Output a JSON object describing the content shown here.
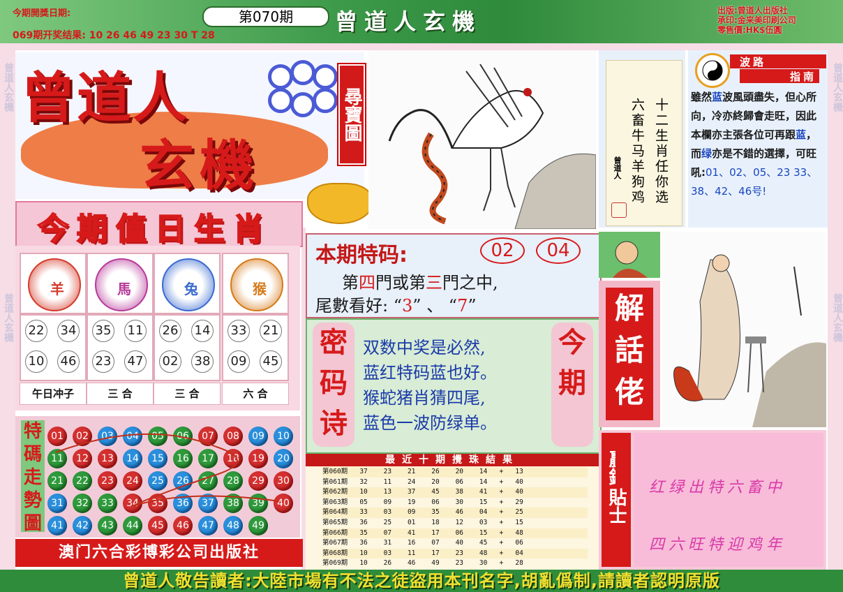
{
  "header": {
    "open_date_label": "今期開獎日期:",
    "last_result_label": "069期开奖结果:",
    "last_result_numbers": "10 26 46 49 23 30 T 28",
    "issue": "第070期",
    "title": "曾道人玄機",
    "publisher_line": "出版:曾道人出版社",
    "printer_line": "承印:金来美印刷公司",
    "price_line": "零售價:HK$伍圓"
  },
  "logo": {
    "line1": "曾道人",
    "line2": "玄機",
    "tag": "尋寶圖"
  },
  "border_text": "曾道人玄機",
  "zodiac_poem": {
    "col1": "十二生肖任你选",
    "col2": "六畜牛马羊狗鸡",
    "signature": "曾道人"
  },
  "wave_guide": {
    "title1": "波路",
    "title2": "指南",
    "text1": "雖然",
    "text_blue": "蓝",
    "text2": "波風頭盡失，但心所向，冷亦終歸會走旺，因此本欄亦主張各位可再跟",
    "text_blue2": "蓝",
    "text3": "，而",
    "text_green": "绿",
    "text4": "亦是不錯的選擇，可旺吼:",
    "numbers": "01、02、05、23 33、38、42、46号!"
  },
  "zodiac_of_day": {
    "title": "今期值日生肖",
    "animals": [
      {
        "name": "羊",
        "icon": "goat-icon"
      },
      {
        "name": "馬",
        "icon": "horse-icon"
      },
      {
        "name": "兔",
        "icon": "rabbit-icon"
      },
      {
        "name": "猴",
        "icon": "monkey-icon"
      }
    ],
    "numbers": [
      [
        "22",
        "34",
        "10",
        "46"
      ],
      [
        "35",
        "11",
        "23",
        "47"
      ],
      [
        "26",
        "14",
        "02",
        "38"
      ],
      [
        "33",
        "21",
        "09",
        "45"
      ]
    ],
    "labels": [
      "午日冲子",
      "三 合",
      "三 合",
      "六 合"
    ]
  },
  "trend": {
    "label": "特碼走勢圖",
    "rows": [
      [
        "01",
        "02",
        "03",
        "04",
        "05",
        "06",
        "07",
        "08",
        "09",
        "10"
      ],
      [
        "11",
        "12",
        "13",
        "14",
        "15",
        "16",
        "17",
        "18",
        "19",
        "20"
      ],
      [
        "21",
        "22",
        "23",
        "24",
        "25",
        "26",
        "27",
        "28",
        "29",
        "30"
      ],
      [
        "31",
        "32",
        "33",
        "34",
        "35",
        "36",
        "37",
        "38",
        "39",
        "40"
      ],
      [
        "41",
        "42",
        "43",
        "44",
        "45",
        "46",
        "47",
        "48",
        "49"
      ]
    ],
    "colors": [
      [
        "r",
        "r",
        "b",
        "b",
        "g",
        "g",
        "r",
        "r",
        "b",
        "b"
      ],
      [
        "g",
        "r",
        "r",
        "b",
        "b",
        "g",
        "g",
        "r",
        "r",
        "b"
      ],
      [
        "g",
        "g",
        "r",
        "r",
        "b",
        "b",
        "g",
        "g",
        "r",
        "r"
      ],
      [
        "b",
        "g",
        "g",
        "r",
        "r",
        "b",
        "b",
        "g",
        "g",
        "r"
      ],
      [
        "b",
        "b",
        "g",
        "g",
        "r",
        "r",
        "b",
        "b",
        "g"
      ]
    ],
    "colors_hex": {
      "r": "#d43030",
      "b": "#2a8fdc",
      "g": "#2f9a3c"
    }
  },
  "publisher_bar": "澳门六合彩博彩公司出版社",
  "special_code": {
    "title": "本期特码:",
    "nums": [
      "02",
      "04"
    ],
    "line1_pre": "第",
    "line1_a": "四",
    "line1_mid": "門或第",
    "line1_b": "三",
    "line1_post": "門之中,",
    "line2_pre": "尾數看好:  “",
    "tail1": "3",
    "line2_mid": "” 、 “",
    "tail2": "7",
    "line2_post": "”"
  },
  "secret_poem": {
    "left_label": "密码诗",
    "right_label": "今期",
    "lines": [
      "双数中奖是必然,",
      "蓝红特码蓝也好。",
      "猴蛇猪肖猜四尾,",
      "蓝色一波防绿单。"
    ]
  },
  "results": {
    "title": "最近十期攪珠結果",
    "rows": [
      {
        "issue": "第060期",
        "nums": [
          "37",
          "23",
          "21",
          "26",
          "20",
          "14"
        ],
        "sp": "13"
      },
      {
        "issue": "第061期",
        "nums": [
          "32",
          "11",
          "24",
          "20",
          "06",
          "14"
        ],
        "sp": "40"
      },
      {
        "issue": "第062期",
        "nums": [
          "10",
          "13",
          "37",
          "45",
          "38",
          "41"
        ],
        "sp": "40"
      },
      {
        "issue": "第063期",
        "nums": [
          "05",
          "09",
          "19",
          "06",
          "30",
          "15"
        ],
        "sp": "29"
      },
      {
        "issue": "第064期",
        "nums": [
          "33",
          "03",
          "09",
          "35",
          "46",
          "04"
        ],
        "sp": "25"
      },
      {
        "issue": "第065期",
        "nums": [
          "36",
          "25",
          "01",
          "18",
          "12",
          "03"
        ],
        "sp": "15"
      },
      {
        "issue": "第066期",
        "nums": [
          "35",
          "07",
          "41",
          "17",
          "06",
          "15"
        ],
        "sp": "48"
      },
      {
        "issue": "第067期",
        "nums": [
          "36",
          "31",
          "16",
          "07",
          "40",
          "45"
        ],
        "sp": "06"
      },
      {
        "issue": "第068期",
        "nums": [
          "10",
          "03",
          "11",
          "17",
          "23",
          "48"
        ],
        "sp": "04"
      },
      {
        "issue": "第069期",
        "nums": [
          "10",
          "26",
          "46",
          "49",
          "23",
          "30"
        ],
        "sp": "28"
      }
    ]
  },
  "jiehua": {
    "label": "解話佬"
  },
  "win_tips": {
    "label1": "贏錢",
    "label2": "貼士",
    "line1": "红绿出特六畜中",
    "line2": "四六旺特迎鸡年"
  },
  "footer": "曾道人敬告讀者:大陸市場有不法之徒盜用本刊名字,胡亂僞制,請讀者認明原版"
}
